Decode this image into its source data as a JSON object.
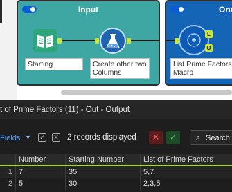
{
  "canvas": {
    "containers": {
      "input_title": "Input",
      "second_title": "One"
    },
    "tools": {
      "starting_number_label": "Starting Number",
      "formula_label": "Create other two Columns",
      "macro_label": "List Prime Factors Macro"
    },
    "anchors": {
      "l": "L",
      "o": "O"
    }
  },
  "results": {
    "title": "t of Prime Factors (11) - Out - Output",
    "toolbar": {
      "fields_label": "Fields",
      "records_text": "2 records displayed",
      "search_label": "Search"
    },
    "table": {
      "columns": [
        "Number",
        "Starting Number",
        "List of Prime Factors"
      ],
      "rows": [
        {
          "record": "1",
          "cells": [
            "7",
            "35",
            "5,7"
          ]
        },
        {
          "record": "2",
          "cells": [
            "5",
            "30",
            "2,3,5"
          ]
        }
      ]
    }
  },
  "colors": {
    "input_container": "#3fa7a3",
    "second_container": "#1565b7",
    "anchor": "#c8e62a",
    "header_underline": "#a8d63a"
  }
}
